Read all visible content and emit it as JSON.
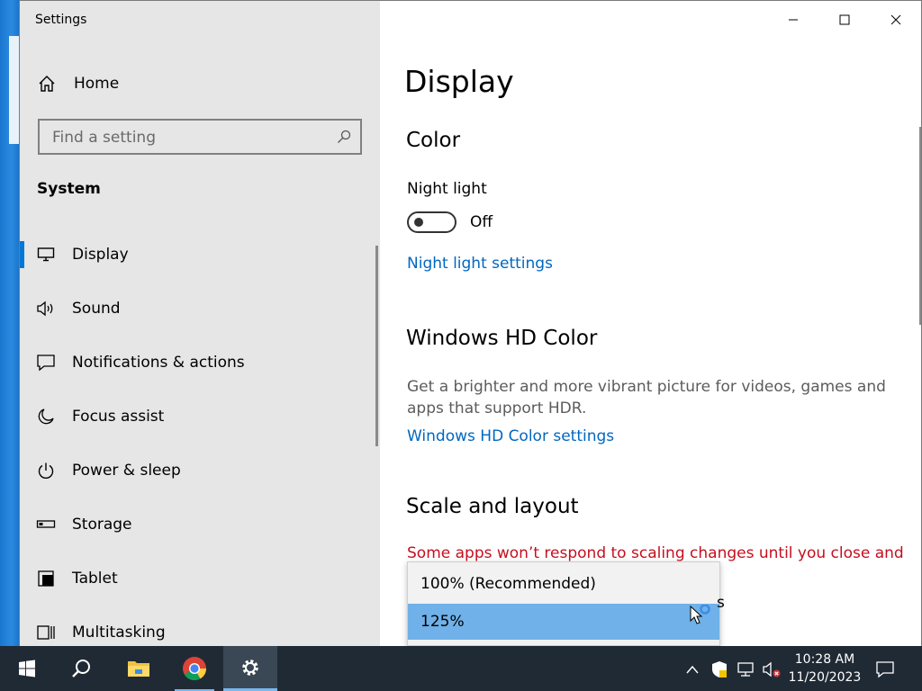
{
  "window": {
    "title": "Settings"
  },
  "sidebar": {
    "home_label": "Home",
    "search_placeholder": "Find a setting",
    "section": "System",
    "items": [
      {
        "label": "Display",
        "icon": "monitor-icon",
        "selected": true
      },
      {
        "label": "Sound",
        "icon": "speaker-icon",
        "selected": false
      },
      {
        "label": "Notifications & actions",
        "icon": "notification-icon",
        "selected": false
      },
      {
        "label": "Focus assist",
        "icon": "moon-icon",
        "selected": false
      },
      {
        "label": "Power & sleep",
        "icon": "power-icon",
        "selected": false
      },
      {
        "label": "Storage",
        "icon": "storage-icon",
        "selected": false
      },
      {
        "label": "Tablet",
        "icon": "tablet-icon",
        "selected": false
      },
      {
        "label": "Multitasking",
        "icon": "multitasking-icon",
        "selected": false
      }
    ]
  },
  "content": {
    "page_title": "Display",
    "color_heading": "Color",
    "night_light_label": "Night light",
    "night_light_state": "Off",
    "night_light_on": false,
    "night_light_settings_link": "Night light settings",
    "hd_color_heading": "Windows HD Color",
    "hd_color_description": "Get a brighter and more vibrant picture for videos, games and apps that support HDR.",
    "hd_color_settings_link": "Windows HD Color settings",
    "scale_heading": "Scale and layout",
    "scale_warning": "Some apps won’t respond to scaling changes until you close and",
    "obscured_fragment": "s"
  },
  "scale_dropdown": {
    "options": [
      "100% (Recommended)",
      "125%"
    ],
    "selected": "125%"
  },
  "taskbar": {
    "apps": [
      "start-icon",
      "search-icon",
      "file-explorer-icon",
      "chrome-icon",
      "settings-icon"
    ],
    "active_app": "settings-icon",
    "time": "10:28 AM",
    "date": "11/20/2023"
  },
  "colors": {
    "accent": "#0078d4",
    "link": "#0067c0",
    "warning": "#c50f1f",
    "dropdown_selected": "#6fb1e8",
    "taskbar": "#202a35"
  }
}
